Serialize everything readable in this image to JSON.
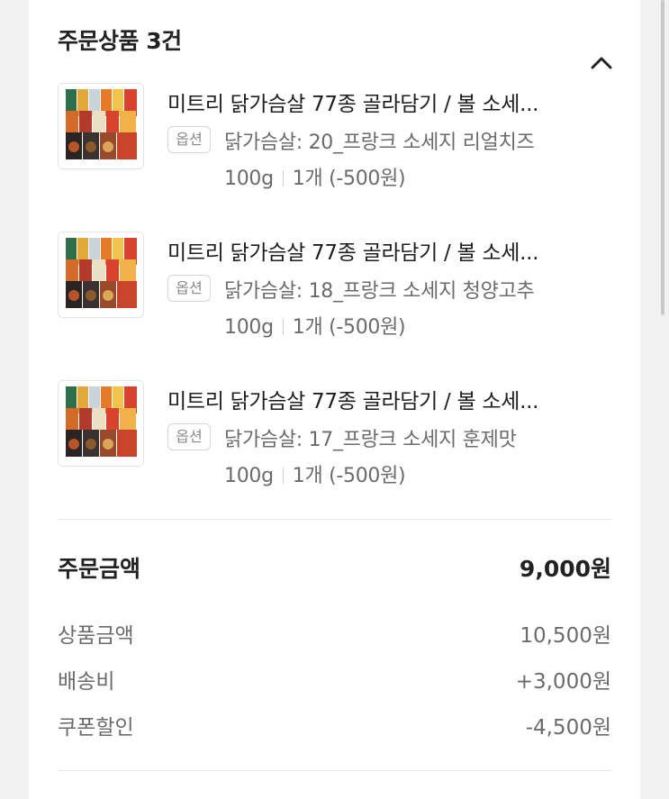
{
  "order_items": {
    "title": "주문상품 3건",
    "collapse_icon": "chevron-up-icon",
    "items": [
      {
        "name": "미트리 닭가슴살 77종 골라담기 / 볼 소세...",
        "option_badge": "옵션",
        "option_line1": "닭가슴살: 20_프랑크 소세지 리얼치즈",
        "option_weight": "100g",
        "option_qty": "1개 (-500원)"
      },
      {
        "name": "미트리 닭가슴살 77종 골라담기 / 볼 소세...",
        "option_badge": "옵션",
        "option_line1": "닭가슴살: 18_프랑크 소세지 청양고추",
        "option_weight": "100g",
        "option_qty": "1개 (-500원)"
      },
      {
        "name": "미트리 닭가슴살 77종 골라담기 / 볼 소세...",
        "option_badge": "옵션",
        "option_line1": "닭가슴살: 17_프랑크 소세지 훈제맛",
        "option_weight": "100g",
        "option_qty": "1개 (-500원)"
      }
    ]
  },
  "summary": {
    "total_label": "주문금액",
    "total_value": "9,000원",
    "rows": [
      {
        "label": "상품금액",
        "value": "10,500원"
      },
      {
        "label": "배송비",
        "value": "+3,000원"
      },
      {
        "label": "쿠폰할인",
        "value": "-4,500원"
      }
    ]
  },
  "colors": {
    "text_primary": "#1e1e1e",
    "text_secondary": "#6b6b6b",
    "divider": "#e6e6e6"
  }
}
